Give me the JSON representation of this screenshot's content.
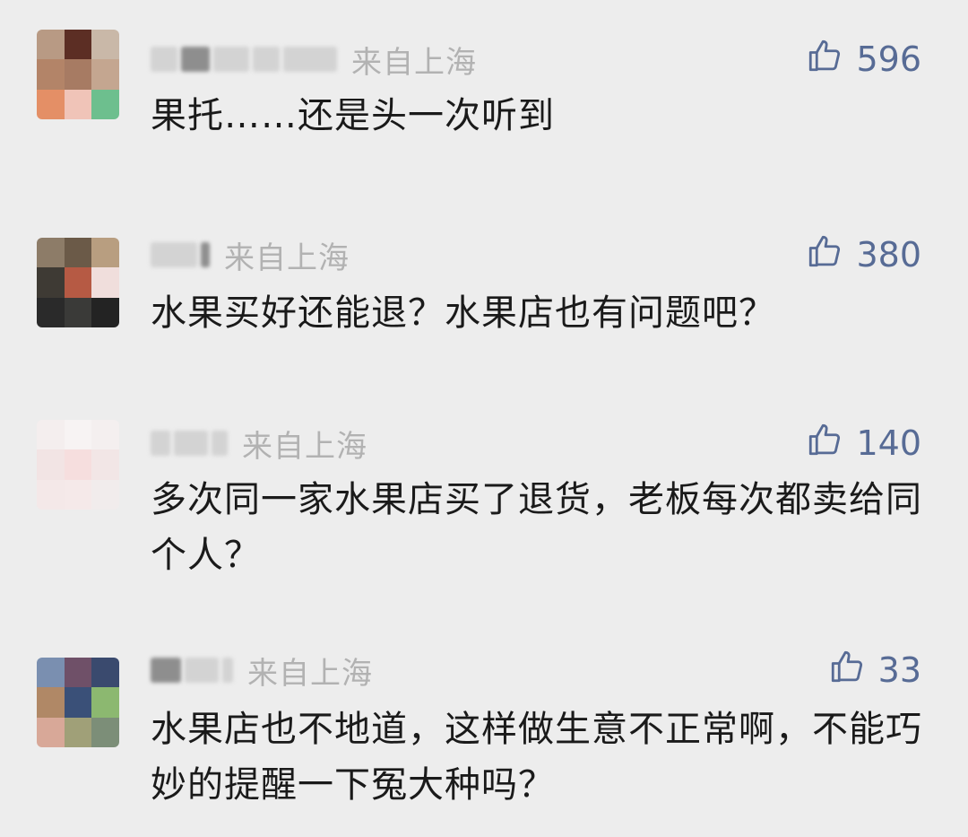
{
  "comments": [
    {
      "location": "来自上海",
      "likes": "596",
      "text": "果托……还是头一次听到"
    },
    {
      "location": "来自上海",
      "likes": "380",
      "text": "水果买好还能退？水果店也有问题吧？"
    },
    {
      "location": "来自上海",
      "likes": "140",
      "text": "多次同一家水果店买了退货，老板每次都卖给同个人？"
    },
    {
      "location": "来自上海",
      "likes": "33",
      "text": "水果店也不地道，这样做生意不正常啊，不能巧妙的提醒一下冤大种吗？"
    }
  ],
  "icons": {
    "like": "thumbs-up-icon"
  },
  "colors": {
    "background": "#ededed",
    "like_accent": "#576b95",
    "location_gray": "#b2b2b2",
    "text": "#1a1a1a"
  }
}
